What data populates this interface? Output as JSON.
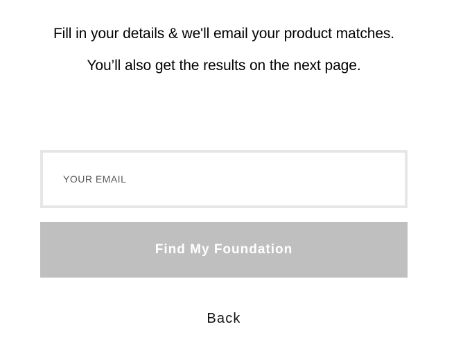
{
  "intro": {
    "text": "Fill in your details & we'll email your product matches. You’ll also get the results on the next page."
  },
  "form": {
    "email_placeholder": "YOUR EMAIL",
    "email_value": "",
    "submit_label": "Find My Foundation",
    "submit_bg_color": "#bfbfbf"
  },
  "nav": {
    "back_label": "Back"
  }
}
